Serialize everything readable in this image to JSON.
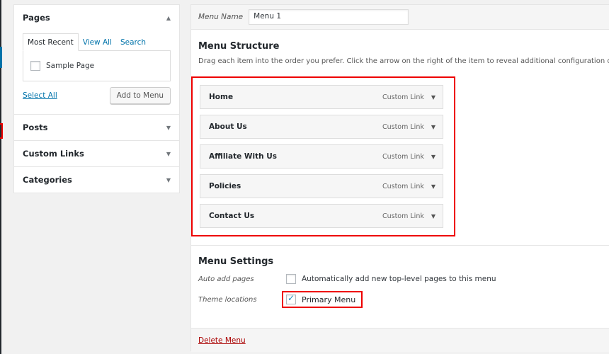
{
  "left_panel": {
    "pages": {
      "title": "Pages",
      "tabs": [
        "Most Recent",
        "View All",
        "Search"
      ],
      "items": [
        {
          "label": "Sample Page",
          "checked": false
        }
      ],
      "select_all_label": "Select All",
      "add_to_menu_label": "Add to Menu"
    },
    "sections": [
      {
        "title": "Posts"
      },
      {
        "title": "Custom Links"
      },
      {
        "title": "Categories"
      }
    ]
  },
  "menu_editor": {
    "menu_name_label": "Menu Name",
    "menu_name_value": "Menu 1",
    "structure_title": "Menu Structure",
    "structure_description": "Drag each item into the order you prefer. Click the arrow on the right of the item to reveal additional configuration options.",
    "items": [
      {
        "title": "Home",
        "type": "Custom Link"
      },
      {
        "title": "About Us",
        "type": "Custom Link"
      },
      {
        "title": "Affiliate With Us",
        "type": "Custom Link"
      },
      {
        "title": "Policies",
        "type": "Custom Link"
      },
      {
        "title": "Contact Us",
        "type": "Custom Link"
      }
    ],
    "settings_title": "Menu Settings",
    "auto_add": {
      "label": "Auto add pages",
      "option": "Automatically add new top-level pages to this menu",
      "checked": false
    },
    "theme_locations": {
      "label": "Theme locations",
      "option": "Primary Menu",
      "checked": true
    },
    "delete_label": "Delete Menu"
  },
  "colors": {
    "accent": "#0073aa",
    "highlight": "#e00000",
    "delete": "#aa0000"
  }
}
